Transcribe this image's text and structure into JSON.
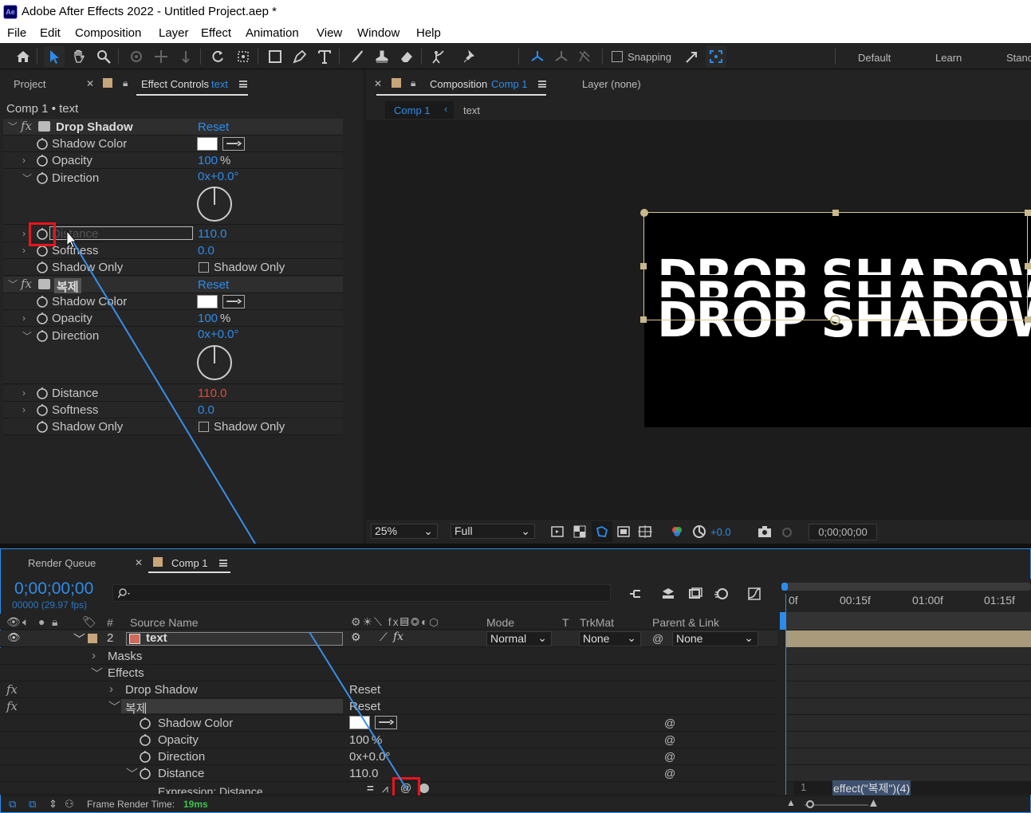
{
  "app": {
    "logo_text": "Ae",
    "window_title": "Adobe After Effects 2022 - Untitled Project.aep *"
  },
  "menu": [
    "File",
    "Edit",
    "Composition",
    "Layer",
    "Effect",
    "Animation",
    "View",
    "Window",
    "Help"
  ],
  "toolbar": {
    "snapping_label": "Snapping",
    "workspaces": [
      "Default",
      "Learn",
      "Stanc"
    ]
  },
  "left_panel": {
    "tab_project": "Project",
    "tab_effect_controls": "Effect Controls",
    "tab_effect_controls_layer": "text",
    "breadcrumb": "Comp 1 • text",
    "effects": [
      {
        "name": "Drop Shadow",
        "reset": "Reset",
        "opacity": "100",
        "opacity_unit": "%",
        "direction": "0x+0.0°",
        "distance": "110.0",
        "softness": "0.0",
        "shadow_only_checkbox_label": "Shadow Only"
      },
      {
        "name": "복제",
        "reset": "Reset",
        "opacity": "100",
        "opacity_unit": "%",
        "direction": "0x+0.0°",
        "distance": "110.0",
        "softness": "0.0",
        "shadow_only_checkbox_label": "Shadow Only"
      }
    ],
    "labels": {
      "shadow_color": "Shadow Color",
      "opacity": "Opacity",
      "direction": "Direction",
      "distance": "Distance",
      "softness": "Softness",
      "shadow_only": "Shadow Only"
    }
  },
  "comp_panel": {
    "tab_label": "Composition",
    "tab_comp_name": "Comp 1",
    "layer_tab": "Layer (none)",
    "breadcrumb_comp": "Comp 1",
    "breadcrumb_layer": "text",
    "canvas_text": "DROP SHADOW",
    "zoom": "25%",
    "resolution": "Full",
    "exposure": "+0.0",
    "timecode": "0;00;00;00"
  },
  "timeline": {
    "tab_render_queue": "Render Queue",
    "tab_comp": "Comp 1",
    "current_time": "0;00;00;00",
    "fps_label": "00000 (29.97 fps)",
    "columns": {
      "number": "#",
      "source_name": "Source Name",
      "mode": "Mode",
      "t": "T",
      "trkmat": "TrkMat",
      "parent": "Parent & Link"
    },
    "layer": {
      "number": "2",
      "name": "text",
      "mode": "Normal",
      "trkmat": "None",
      "parent": "None"
    },
    "tree": {
      "masks": "Masks",
      "effects": "Effects",
      "effect1": "Drop Shadow",
      "effect1_reset": "Reset",
      "effect2": "복제",
      "effect2_reset": "Reset",
      "shadow_color": "Shadow Color",
      "opacity": "Opacity",
      "opacity_value": "100",
      "opacity_unit": "%",
      "direction": "Direction",
      "direction_value": "0x+0.0°",
      "distance": "Distance",
      "distance_value": "110.0",
      "expression": "Expression: Distance"
    },
    "ruler": [
      "0f",
      "00:15f",
      "01:00f",
      "01:15f"
    ],
    "expression_line": "1",
    "expression_text": "effect(\"복제\")(4)",
    "frame_render_label": "Frame Render Time:",
    "frame_render_value": "19ms"
  }
}
